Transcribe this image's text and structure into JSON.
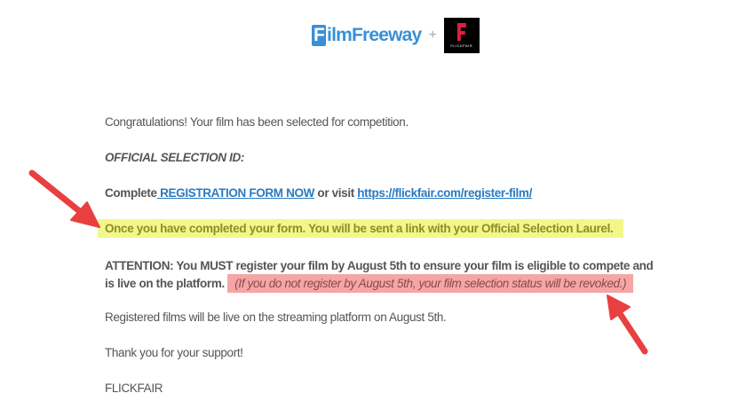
{
  "header": {
    "logo_left": "FilmFreeway",
    "plus": "+",
    "logo_right": "FLICKFAIR"
  },
  "email": {
    "congrats": "Congratulations! Your film has been selected for competition.",
    "selection_id_label": "OFFICIAL SELECTION ID:",
    "complete_prefix": "Complete",
    "registration_link": " REGISTRATION FORM NOW",
    "or_visit": " or visit ",
    "url_link": "https://flickfair.com/register-film/",
    "highlight_yellow": "Once you have completed your form. You will be sent a link with your Official Selection Laurel.",
    "attention_line1": "ATTENTION: You MUST register your film by August 5th to ensure your film is eligible to compete and",
    "attention_line2": "is live on the platform.",
    "highlight_red": "(If you do not register by August 5th, your film selection status will be revoked.)",
    "registered": "Registered films will be live on the streaming platform on August 5th.",
    "thanks": "Thank you for your support!",
    "signature": "FLICKFAIR"
  },
  "colors": {
    "arrow": "#e84040",
    "yellow": "#f3f78a",
    "red": "#f6a5a5",
    "link": "#2a7ac0"
  }
}
